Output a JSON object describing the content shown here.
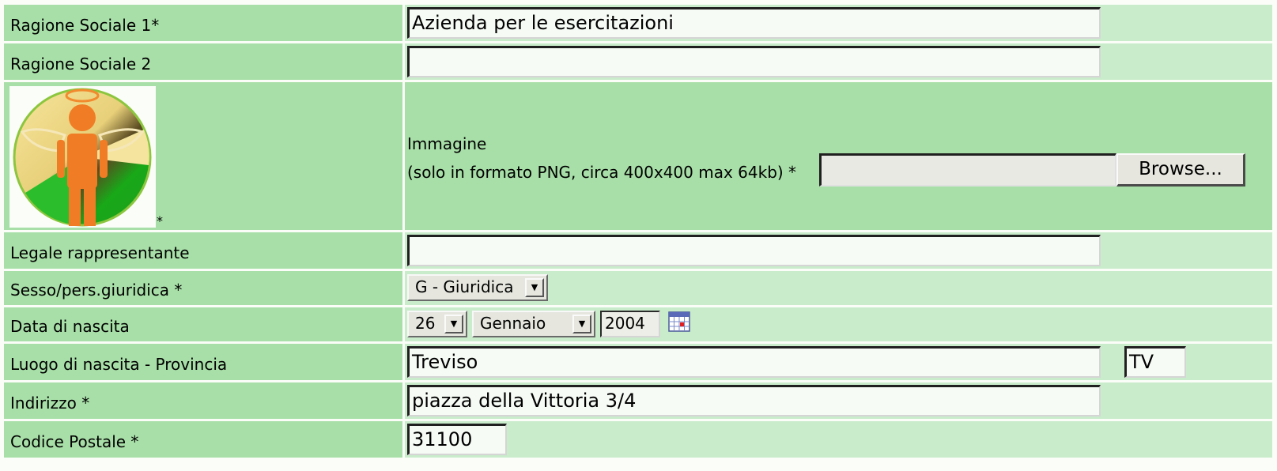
{
  "rows": {
    "ragione1": {
      "label": "Ragione Sociale 1*",
      "value": "Azienda per le esercitazioni"
    },
    "ragione2": {
      "label": "Ragione Sociale 2",
      "value": ""
    },
    "immagine": {
      "label_line1": "Immagine",
      "label_line2": "(solo in formato PNG, circa 400x400 max 64kb) *",
      "photo_marker": "*",
      "browse_label": "Browse...",
      "photo_icon": "angel-logo-icon"
    },
    "legale": {
      "label": "Legale rappresentante",
      "value": ""
    },
    "sesso": {
      "label": "Sesso/pers.giuridica *",
      "selected": "G - Giuridica"
    },
    "data_nascita": {
      "label": "Data di nascita",
      "day": "26",
      "month": "Gennaio",
      "year": "2004",
      "calendar_icon": "calendar-icon"
    },
    "luogo": {
      "label": "Luogo di nascita - Provincia",
      "city": "Treviso",
      "province": "TV"
    },
    "indirizzo": {
      "label": "Indirizzo *",
      "value": "piazza della Vittoria 3/4"
    },
    "cap": {
      "label": "Codice Postale *",
      "value": "31100"
    }
  },
  "colors": {
    "label_bg": "#a8dfa8",
    "field_bg": "#c9eccb",
    "input_bg": "#f6fbf5",
    "border": "#fafdf8"
  }
}
